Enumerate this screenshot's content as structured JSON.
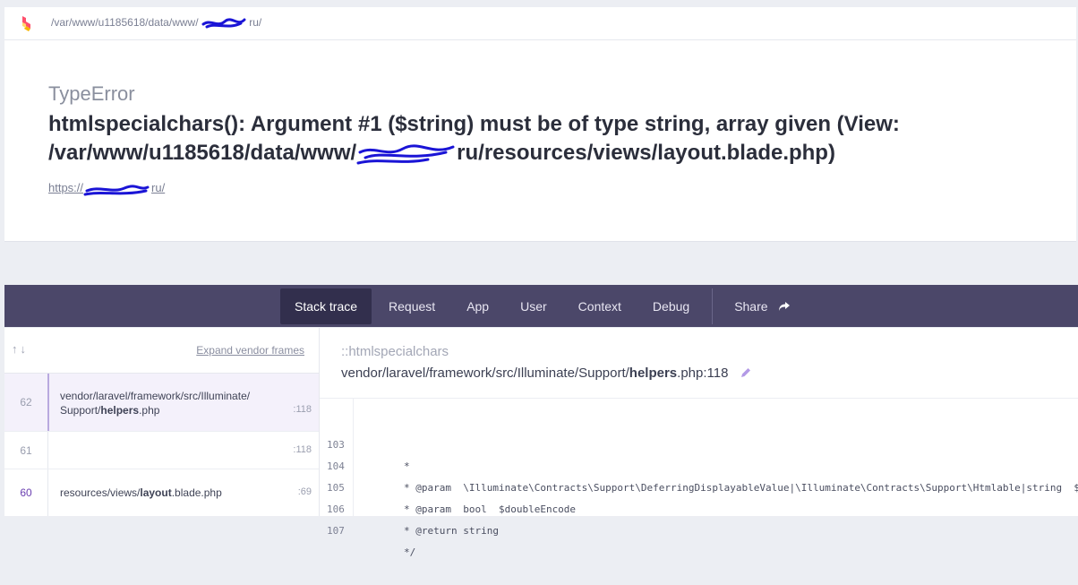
{
  "topbar": {
    "path": "/var/www/u1185618/data/www/",
    "path_tail": "ru/"
  },
  "error": {
    "class": "TypeError",
    "message_line1": "htmlspecialchars(): Argument #1 ($string) must be of type string, array given (View:",
    "message_line2_start": "/var/www/u1185618/data/www/",
    "message_line2_end": "ru/resources/views/layout.blade.php)",
    "url_start": "https://",
    "url_end": "ru/"
  },
  "tabs": [
    {
      "label": "Stack trace",
      "active": true
    },
    {
      "label": "Request"
    },
    {
      "label": "App"
    },
    {
      "label": "User"
    },
    {
      "label": "Context"
    },
    {
      "label": "Debug"
    }
  ],
  "share_label": "Share",
  "frames_header": {
    "expand_label": "Expand vendor frames"
  },
  "frames": [
    {
      "number": "62",
      "file_dir": "vendor/laravel/framework/src/Illuminate/",
      "file_dir2": "Support/",
      "file_name": "helpers",
      "file_ext": ".php",
      "line": ":118"
    },
    {
      "number": "61",
      "line": ":118"
    },
    {
      "number": "60",
      "file_dir": "resources/views/",
      "file_name": "layout",
      "file_ext": ".blade.php",
      "line": ":69"
    }
  ],
  "detail": {
    "function": "::htmlspecialchars",
    "path_start": "vendor/laravel/framework/src/Illuminate/Support/",
    "path_bold": "helpers",
    "path_end": ".php:118"
  },
  "code": [
    {
      "ln": "103",
      "text": "*"
    },
    {
      "ln": "104",
      "text": "* @param  \\Illuminate\\Contracts\\Support\\DeferringDisplayableValue|\\Illuminate\\Contracts\\Support\\Htmlable|string  $"
    },
    {
      "ln": "105",
      "text": "* @param  bool  $doubleEncode"
    },
    {
      "ln": "106",
      "text": "* @return string"
    },
    {
      "ln": "107",
      "text": "*/"
    }
  ],
  "colors": {
    "accent": "#4b4769",
    "accent_dark": "#322f4d",
    "redaction": "#1a14d6"
  }
}
